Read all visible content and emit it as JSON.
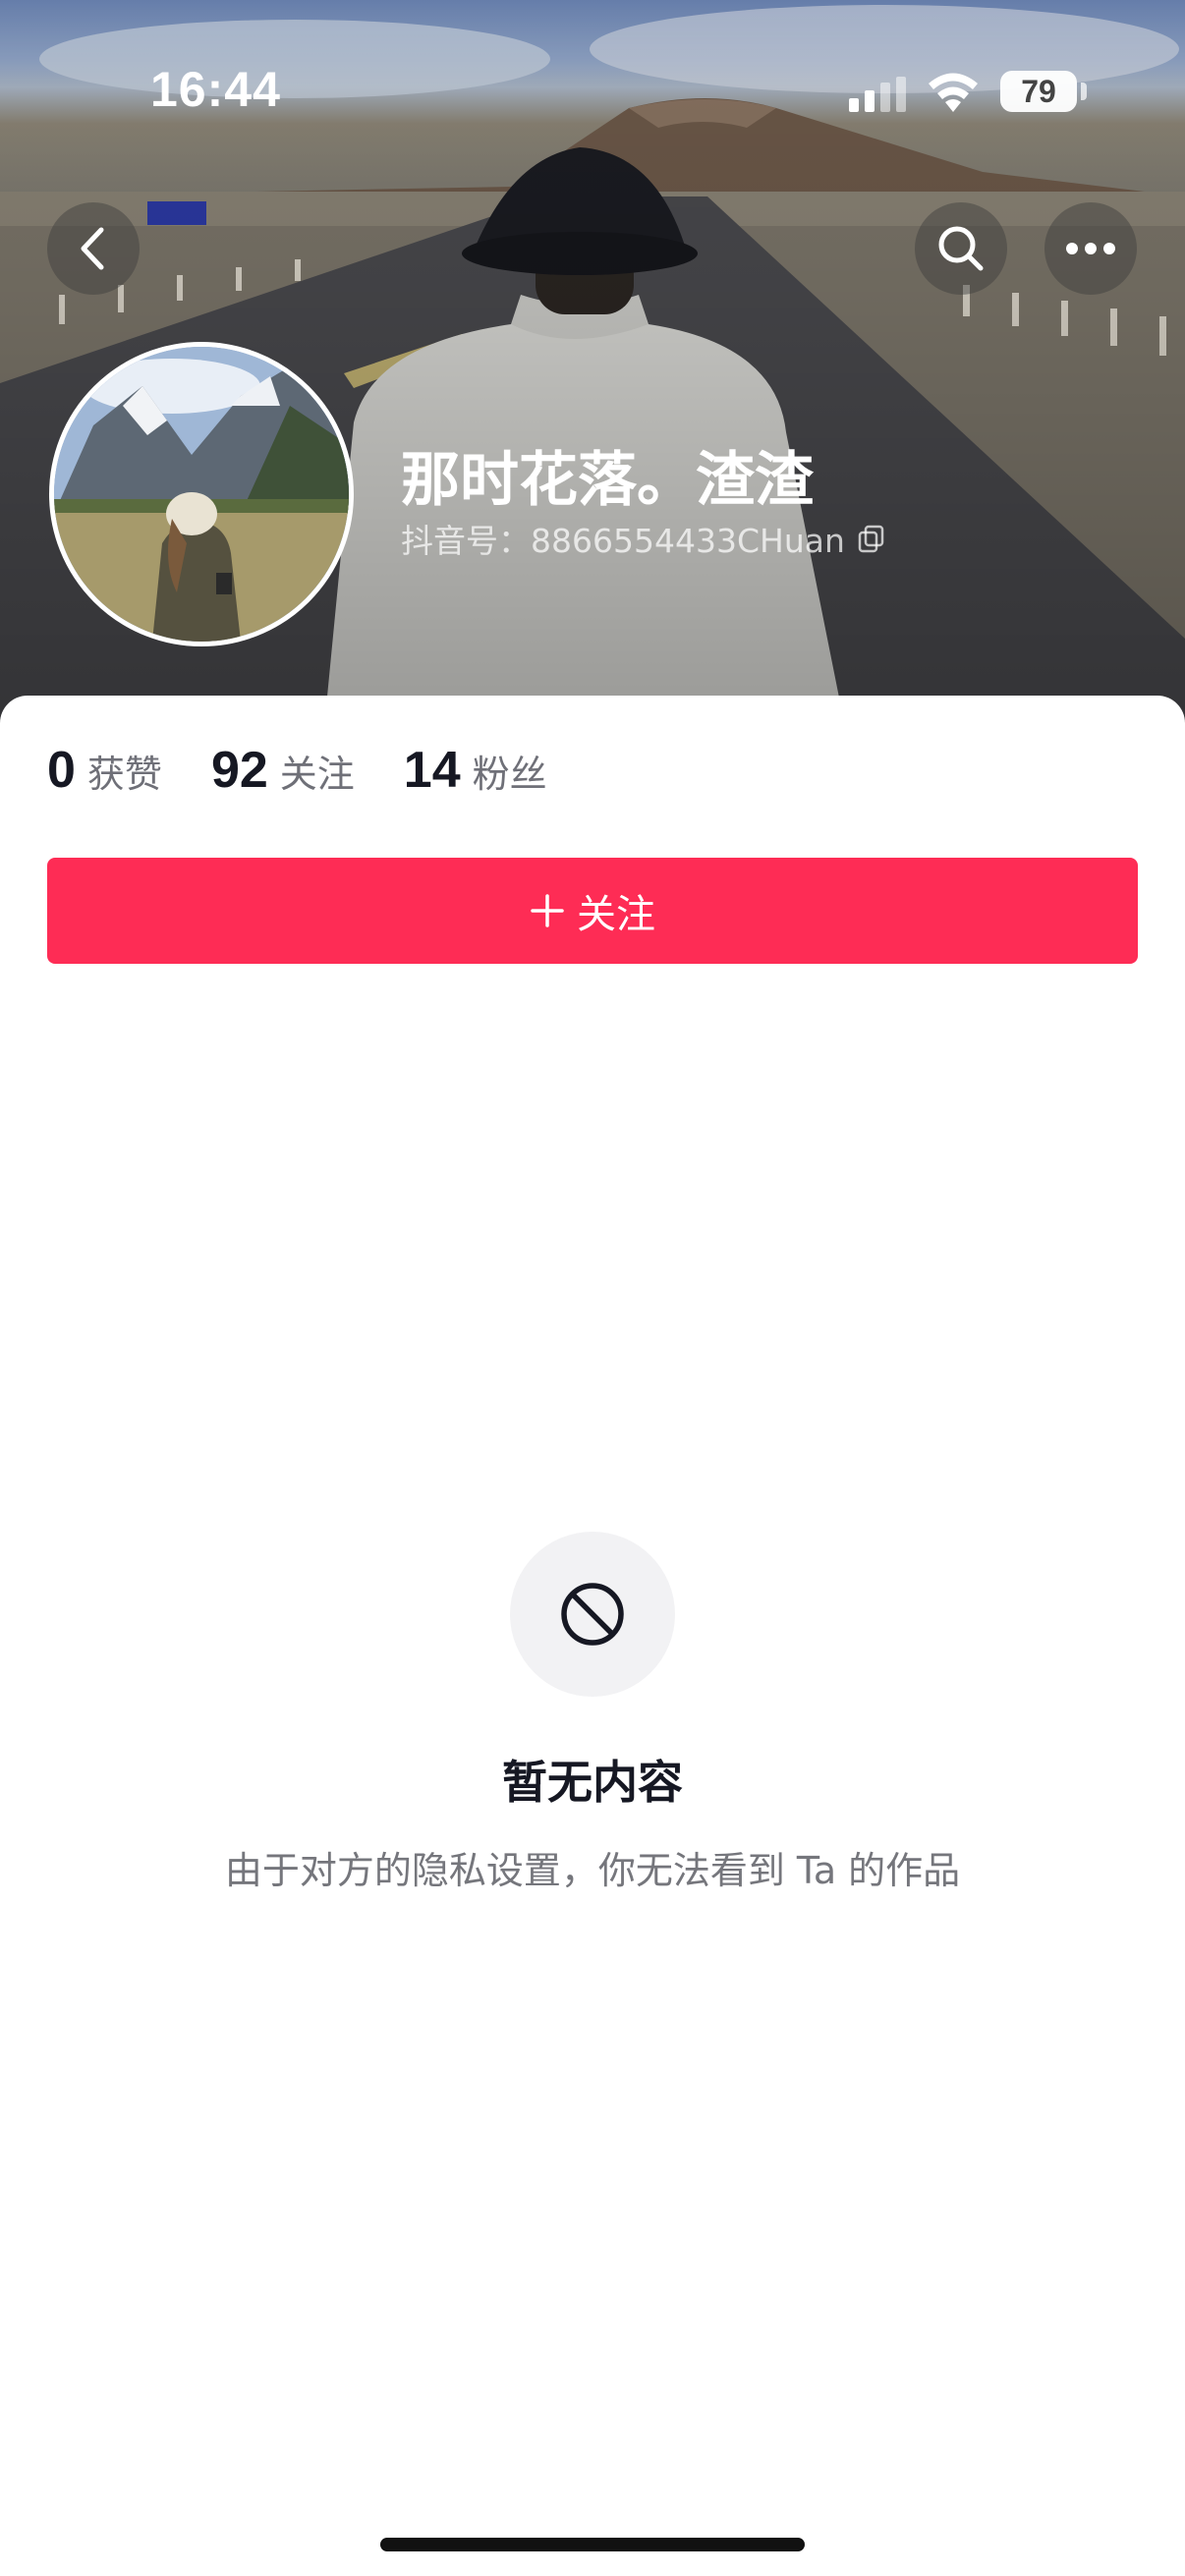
{
  "status_bar": {
    "time": "16:44",
    "battery": "79"
  },
  "icons": {
    "back": "chevron-left-icon",
    "search": "search-icon",
    "more": "more-dots-icon",
    "copy": "copy-icon",
    "plus": "plus-icon",
    "empty": "prohibited-icon"
  },
  "profile": {
    "nickname": "那时花落。渣渣",
    "douyin_id": "抖音号：8866554433CHuan"
  },
  "stats": [
    {
      "value": "0",
      "label": "获赞"
    },
    {
      "value": "92",
      "label": "关注"
    },
    {
      "value": "14",
      "label": "粉丝"
    }
  ],
  "follow_button": {
    "label": "关注"
  },
  "empty_state": {
    "title": "暂无内容",
    "description": "由于对方的隐私设置，你无法看到 Ta 的作品"
  },
  "colors": {
    "accent": "#fe2c55",
    "text_primary": "#161823",
    "text_secondary": "#75767c"
  }
}
